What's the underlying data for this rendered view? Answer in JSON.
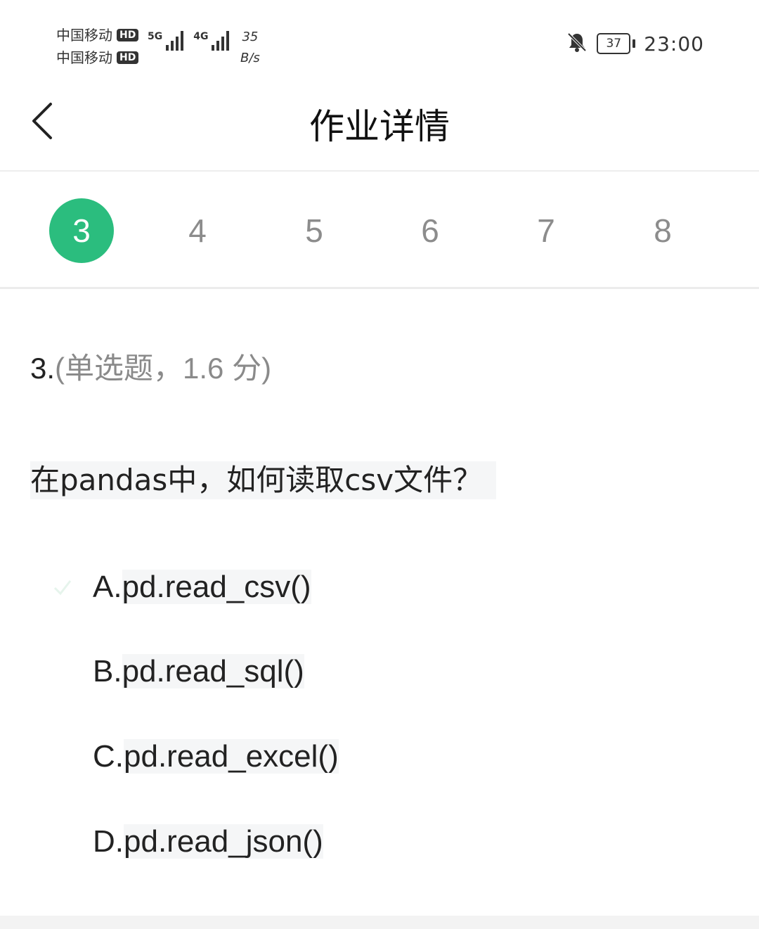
{
  "status_bar": {
    "carrier_1": "中国移动",
    "carrier_2": "中国移动",
    "hd_badge": "HD",
    "net_1": "5G",
    "net_2": "4G",
    "speed_value": "35",
    "speed_unit": "B/s",
    "battery": "37",
    "time": "23:00"
  },
  "header": {
    "title": "作业详情"
  },
  "question_tabs": [
    "3",
    "4",
    "5",
    "6",
    "7",
    "8"
  ],
  "active_tab": "3",
  "question": {
    "number": "3.",
    "meta": "(单选题，1.6 分)",
    "text": "在pandas中，如何读取csv文件？"
  },
  "options": [
    {
      "letter": "A.",
      "text": "pd.read_csv()"
    },
    {
      "letter": "B.",
      "text": "pd.read_sql()"
    },
    {
      "letter": "C.",
      "text": "pd.read_excel()"
    },
    {
      "letter": "D.",
      "text": "pd.read_json()"
    }
  ],
  "colors": {
    "accent": "#2bbd7e",
    "tab_inactive": "#8c8c8c",
    "code_bg": "#f5f6f7"
  }
}
